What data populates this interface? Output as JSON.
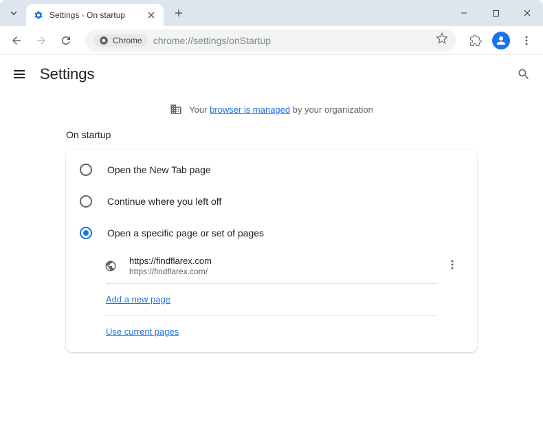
{
  "tab": {
    "title": "Settings - On startup"
  },
  "addressbar": {
    "chip": "Chrome",
    "url": "chrome://settings/onStartup"
  },
  "settings": {
    "title": "Settings"
  },
  "managed": {
    "prefix": "Your ",
    "link": "browser is managed",
    "suffix": " by your organization"
  },
  "section": {
    "title": "On startup"
  },
  "radios": {
    "newTab": "Open the New Tab page",
    "continue": "Continue where you left off",
    "specific": "Open a specific page or set of pages"
  },
  "site": {
    "name": "https://findflarex.com",
    "url": "https://findflarex.com/"
  },
  "links": {
    "addPage": "Add a new page",
    "useCurrent": "Use current pages"
  }
}
